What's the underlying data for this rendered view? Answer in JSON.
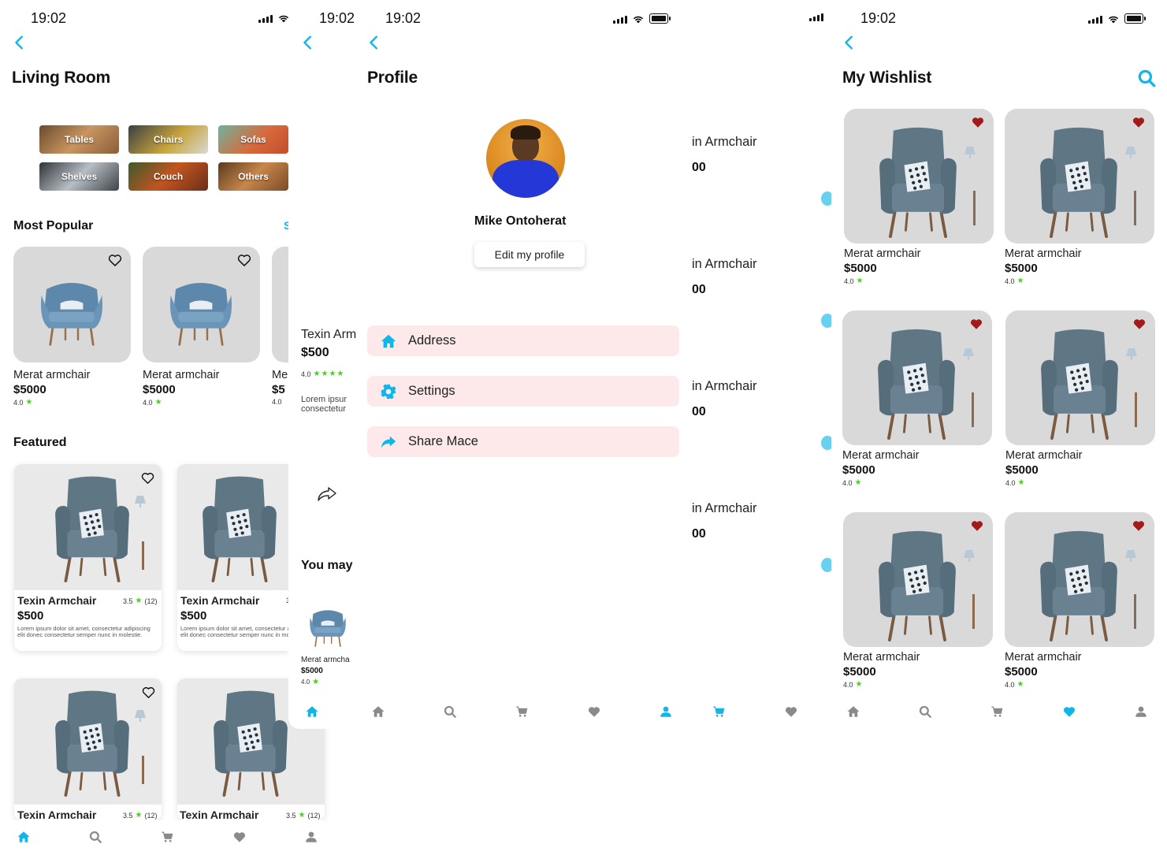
{
  "status_time": "19:02",
  "living_room": {
    "title": "Living Room",
    "categories": [
      "Tables",
      "Chairs",
      "Sofas",
      "Shelves",
      "Couch",
      "Others"
    ],
    "most_popular": {
      "heading": "Most Popular",
      "see_all": "S",
      "items": [
        {
          "name": "Merat armchair",
          "price": "$5000",
          "rating": "4.0"
        },
        {
          "name": "Merat armchair",
          "price": "$5000",
          "rating": "4.0"
        },
        {
          "name": "Me",
          "price": "$5",
          "rating": "4.0"
        }
      ]
    },
    "featured": {
      "heading": "Featured",
      "items": [
        {
          "name": "Texin Armchair",
          "price": "$500",
          "rating": "3.5",
          "count": "(12)",
          "desc": "Lorem ipsum dolor sit amet, consectetur adipiscing elit donec consectetur semper nunc in molestie."
        },
        {
          "name": "Texin Armchair",
          "price": "$500",
          "rating": "3",
          "count": "",
          "desc": "Lorem ipsum dolor sit amet, consectetur adipiscing elit donec consectetur semper nunc in molestie."
        },
        {
          "name": "Texin Armchair",
          "rating": "3.5",
          "count": "(12)"
        },
        {
          "name": "Texin Armchair",
          "rating": "3.5",
          "count": "(12)"
        }
      ]
    }
  },
  "detail_peek": {
    "name": "Texin Arm",
    "price": "$500",
    "rating": "4.0",
    "desc_line1": "Lorem ipsur",
    "desc_line2": "consectetur",
    "you_may": "You may",
    "rec_name": "Merat armcha",
    "rec_price": "$5000",
    "rec_rating": "4.0"
  },
  "profile": {
    "title": "Profile",
    "user_name": "Mike Ontoherat",
    "edit_button": "Edit my profile",
    "menu": [
      {
        "label": "Address",
        "icon": "home-icon"
      },
      {
        "label": "Settings",
        "icon": "gear-icon"
      },
      {
        "label": "Share Mace",
        "icon": "share-icon"
      }
    ]
  },
  "cart_peek": {
    "items": [
      {
        "name": "in Armchair",
        "price": "00"
      },
      {
        "name": "in Armchair",
        "price": "00"
      },
      {
        "name": "in Armchair",
        "price": "00"
      },
      {
        "name": "in Armchair",
        "price": "00"
      }
    ]
  },
  "wishlist": {
    "title": "My Wishlist",
    "items": [
      {
        "name": "Merat armchair",
        "price": "$5000",
        "rating": "4.0"
      },
      {
        "name": "Merat armchair",
        "price": "$5000",
        "rating": "4.0"
      },
      {
        "name": "Merat armchair",
        "price": "$5000",
        "rating": "4.0"
      },
      {
        "name": "Merat armchair",
        "price": "$5000",
        "rating": "4.0"
      },
      {
        "name": "Merat armchair",
        "price": "$5000",
        "rating": "4.0"
      },
      {
        "name": "Merat armchair",
        "price": "$5000",
        "rating": "4.0"
      }
    ]
  },
  "colors": {
    "accent": "#0fb6ea",
    "favorite": "#a31a1a",
    "star": "#49d11c",
    "menu_bg": "#fde9e9",
    "nav_inactive": "#8a8a8a"
  }
}
